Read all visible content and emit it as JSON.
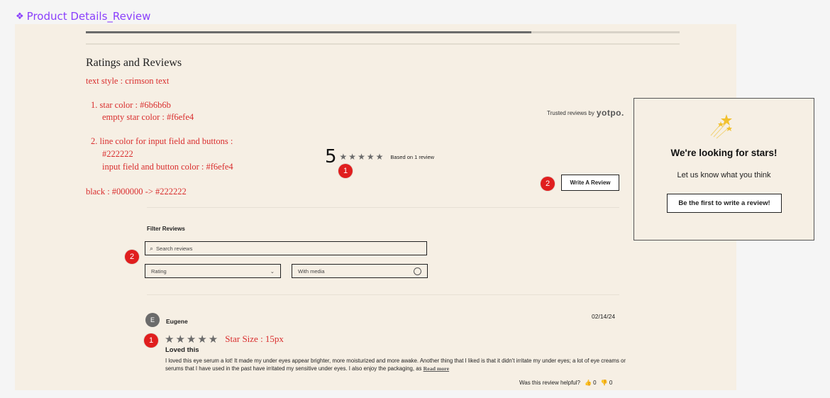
{
  "frame": {
    "title": "Product Details_Review",
    "icon": "component-diamond-icon"
  },
  "progress": {
    "fraction": 0.75
  },
  "section": {
    "heading": "Ratings and Reviews"
  },
  "notes": {
    "text_style": "text style : crimson text",
    "star_color": "1. star color : #6b6b6b",
    "empty_star": "empty star color :  #f6efe4",
    "line_color": "2. line color for input field and buttons   :",
    "line_value": "#222222",
    "input_color": "input field and button color : #f6efe4",
    "black": "black : #000000 -> #222222"
  },
  "trusted": {
    "prefix": "Trusted reviews by",
    "brand": "yotpo."
  },
  "summary": {
    "average": "5",
    "stars": "★★★★★",
    "based_on": "Based on 1 review",
    "rating": 5
  },
  "write_button": {
    "label": "Write A Review"
  },
  "badges": {
    "one": "1",
    "two": "2"
  },
  "filter": {
    "title": "Filter Reviews",
    "search_placeholder": "Search reviews",
    "rating_select": "Rating",
    "media_select": "With media"
  },
  "review": {
    "avatar_initial": "E",
    "name": "Eugene",
    "date": "02/14/24",
    "stars": "★★★★★",
    "size_note": "Star Size : 15px",
    "title": "Loved this",
    "body": "I loved this eye serum a lot! It made my under eyes appear brighter, more moisturized and more awake. Another thing that I liked is that it didn't irritate my under eyes; a lot of eye creams or serums that I have used in the past have irritated my sensitive under eyes. I also enjoy the packaging, as",
    "read_more": "Read more",
    "helpful_label": "Was this review helpful?",
    "up_count": "0",
    "down_count": "0"
  },
  "popup": {
    "title": "We're looking for stars!",
    "subtitle": "Let us know what you think",
    "button": "Be the first to write a review!"
  },
  "colors": {
    "star": "#6b6b6b",
    "empty_star": "#f6efe4",
    "line": "#222222",
    "background": "#f6efe4",
    "annotation": "#d92d2d",
    "badge": "#e01e1e"
  }
}
